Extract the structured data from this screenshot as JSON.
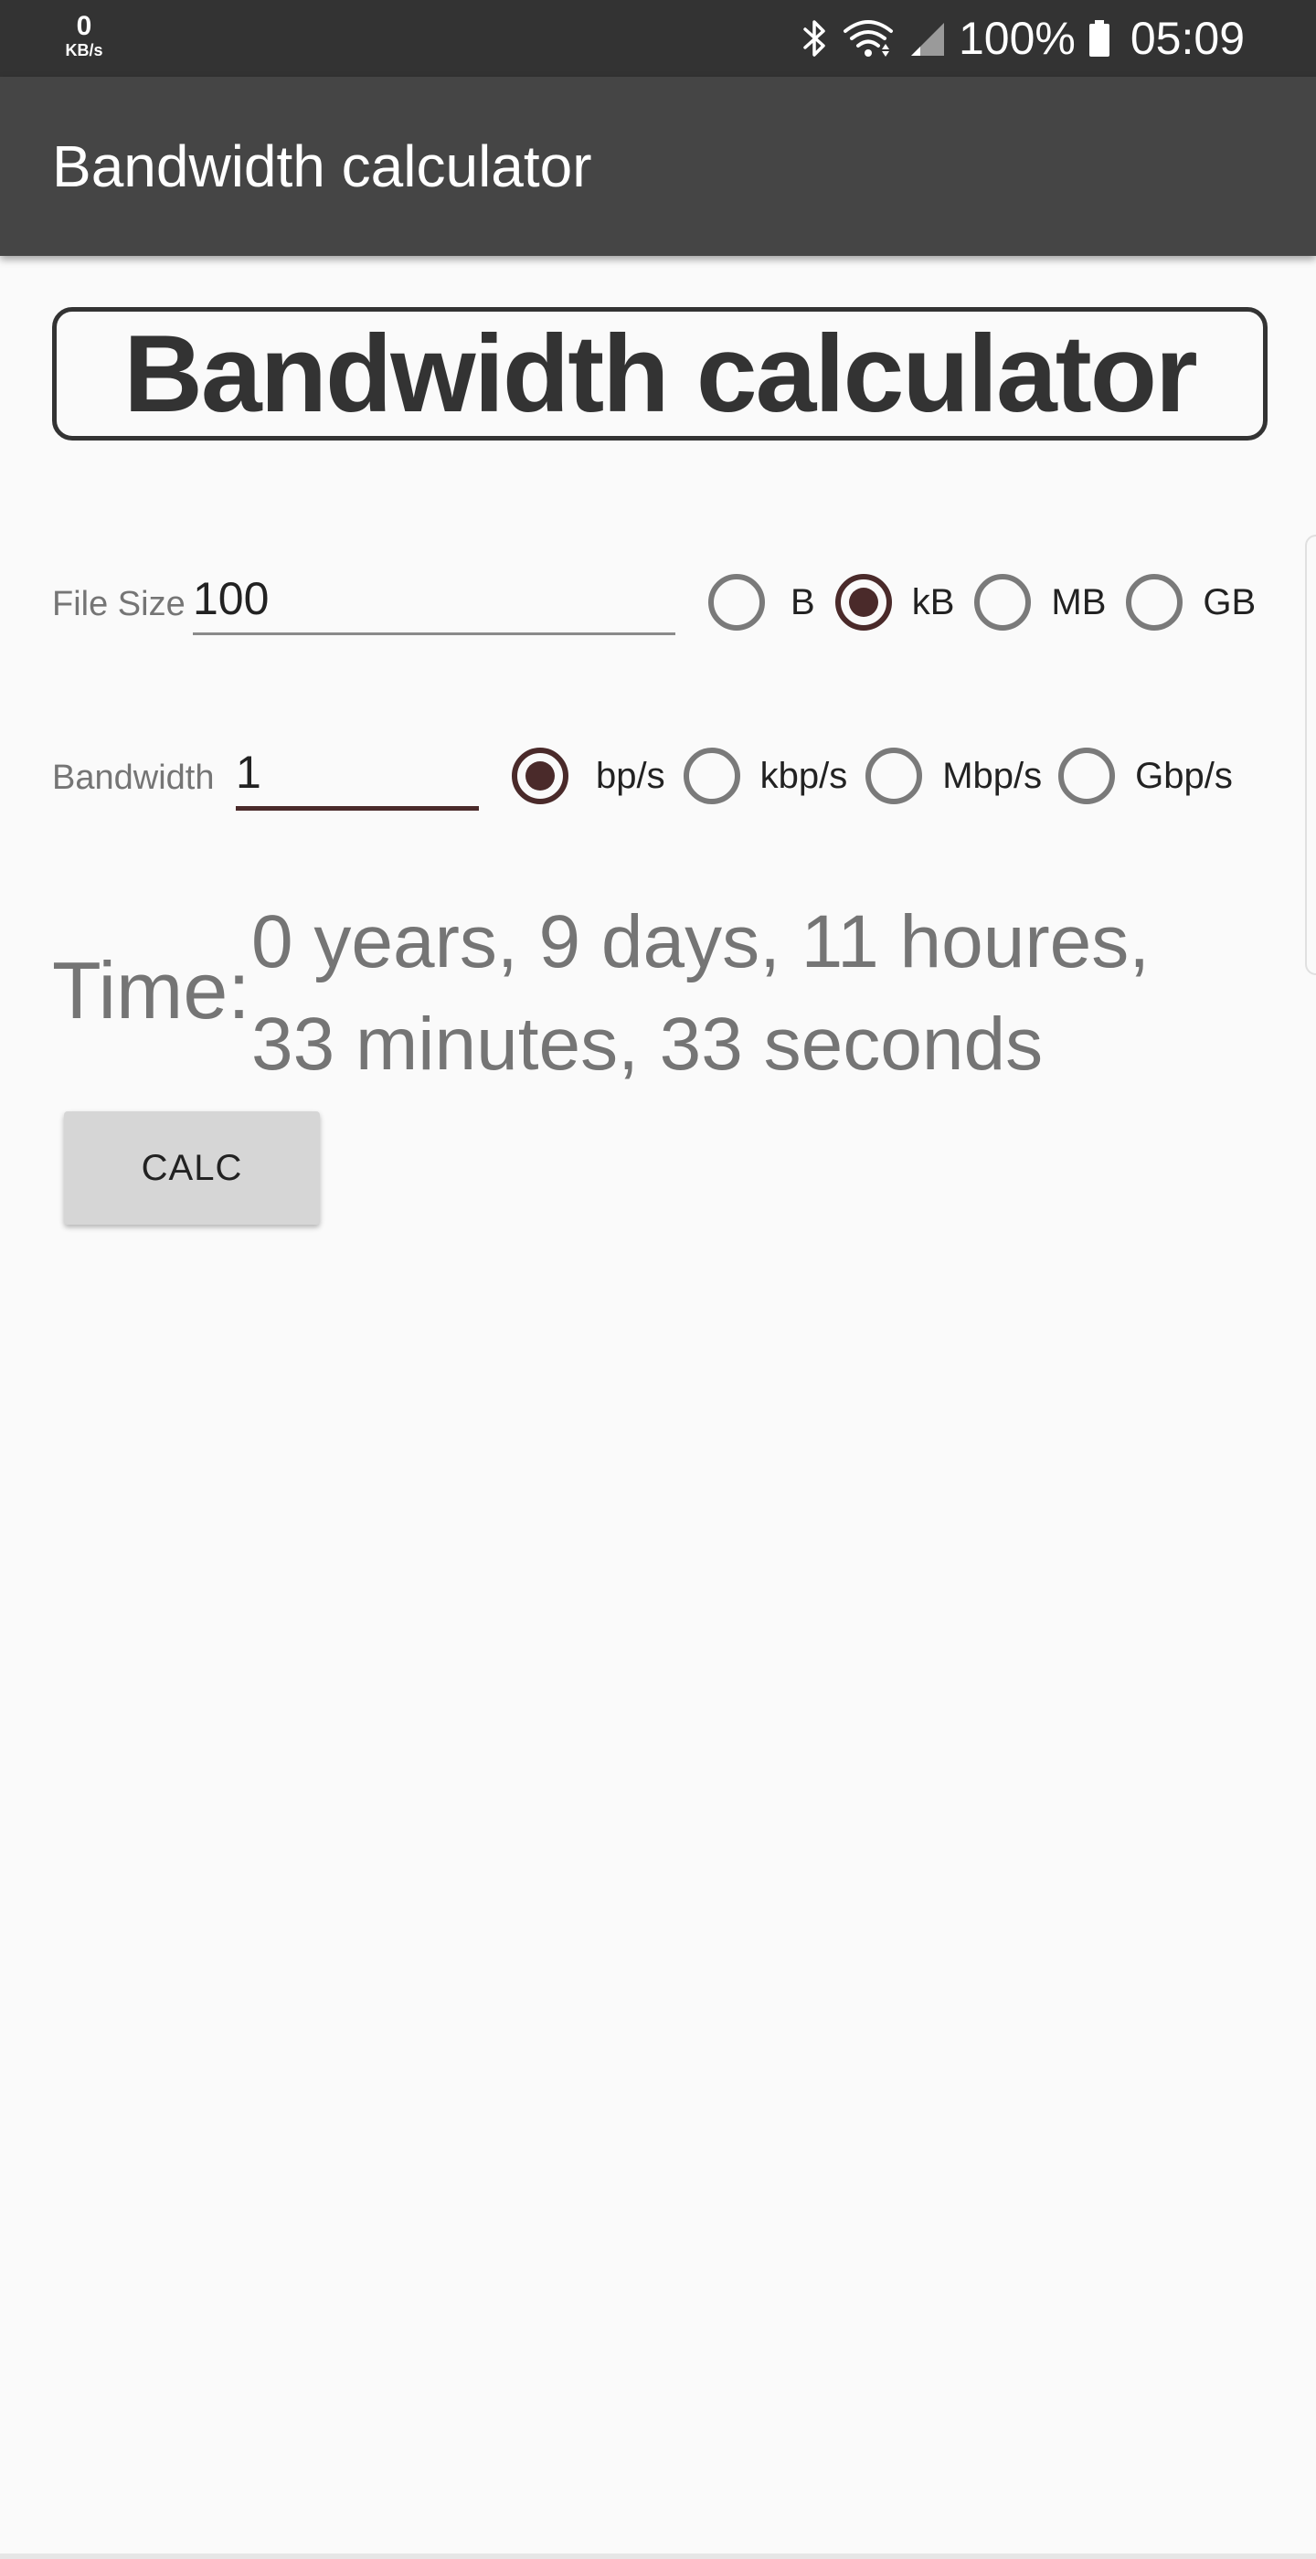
{
  "status_bar": {
    "net_speed_value": "0",
    "net_speed_unit": "KB/s",
    "battery_percent": "100%",
    "time": "05:09",
    "icons": [
      "bluetooth-icon",
      "wifi-icon",
      "signal-icon",
      "battery-icon"
    ]
  },
  "app_bar": {
    "title": "Bandwidth calculator"
  },
  "heading": {
    "text": "Bandwidth calculator"
  },
  "file_size": {
    "label": "File Size",
    "value": "100",
    "units": [
      "B",
      "kB",
      "MB",
      "GB"
    ],
    "selected_unit": "kB"
  },
  "bandwidth": {
    "label": "Bandwidth",
    "value": "1",
    "units": [
      "bp/s",
      "kbp/s",
      "Mbp/s",
      "Gbp/s"
    ],
    "selected_unit": "bp/s"
  },
  "result": {
    "label": "Time:",
    "line1": "0 years, 9 days, 11 houres,",
    "line2": "33 minutes, 33 seconds"
  },
  "calc_button": {
    "label": "CALC"
  },
  "colors": {
    "status_bar": "#333333",
    "app_bar": "#454545",
    "accent": "#4a2a2a",
    "background": "#fafafa",
    "muted_text": "#757575"
  }
}
